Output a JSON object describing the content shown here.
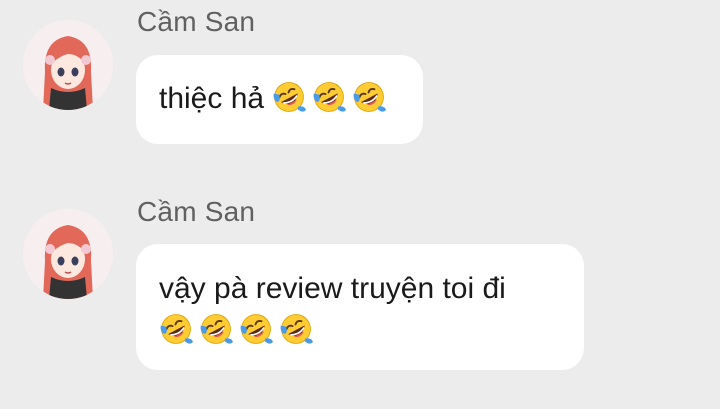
{
  "messages": [
    {
      "sender": "Cầm San",
      "avatar_icon": "anime-girl-avatar-icon",
      "text": "thiệc hả",
      "emojis": [
        "rolling-on-floor-laughing-emoji",
        "rolling-on-floor-laughing-emoji",
        "rolling-on-floor-laughing-emoji"
      ]
    },
    {
      "sender": "Cầm San",
      "avatar_icon": "anime-girl-avatar-icon",
      "text": "vậy pà review truyện toi đi",
      "emojis": [
        "rolling-on-floor-laughing-emoji",
        "rolling-on-floor-laughing-emoji",
        "rolling-on-floor-laughing-emoji",
        "rolling-on-floor-laughing-emoji"
      ]
    }
  ],
  "colors": {
    "background": "#ececec",
    "bubble": "#ffffff",
    "sender_name": "#606060",
    "message_text": "#1a1a1a",
    "avatar_hair": "#e2685a",
    "emoji_face": "#ffcc33",
    "emoji_tears": "#4a9be8"
  }
}
